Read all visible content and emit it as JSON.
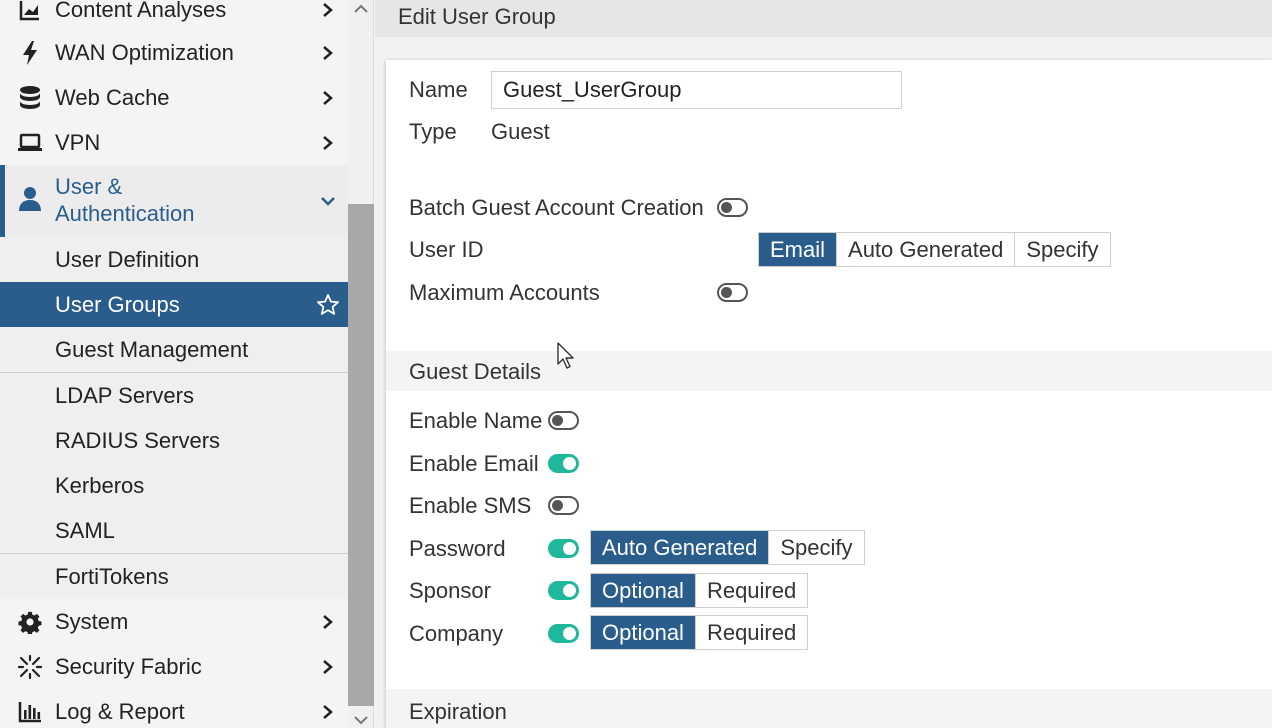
{
  "sidebar": {
    "items_top": [
      {
        "label": "Content Analyses",
        "icon": "chart-area-icon"
      },
      {
        "label": "WAN Optimization",
        "icon": "bolt-icon"
      },
      {
        "label": "Web Cache",
        "icon": "database-icon"
      },
      {
        "label": "VPN",
        "icon": "laptop-icon"
      }
    ],
    "user_auth": {
      "label_line1": "User &",
      "label_line2": "Authentication",
      "icon": "user-icon"
    },
    "sub_items": [
      {
        "label": "User Definition"
      },
      {
        "label": "User Groups"
      },
      {
        "label": "Guest Management"
      },
      {
        "label": "LDAP Servers"
      },
      {
        "label": "RADIUS Servers"
      },
      {
        "label": "Kerberos"
      },
      {
        "label": "SAML"
      },
      {
        "label": "FortiTokens"
      }
    ],
    "items_bottom": [
      {
        "label": "System",
        "icon": "gear-icon"
      },
      {
        "label": "Security Fabric",
        "icon": "security-fabric-icon"
      },
      {
        "label": "Log & Report",
        "icon": "bar-chart-icon"
      }
    ]
  },
  "page": {
    "title": "Edit User Group"
  },
  "form": {
    "name_label": "Name",
    "name_value": "Guest_UserGroup",
    "type_label": "Type",
    "type_value": "Guest",
    "batch_label": "Batch Guest Account Creation",
    "batch_enabled": false,
    "userid_label": "User ID",
    "userid_options": [
      "Email",
      "Auto Generated",
      "Specify"
    ],
    "userid_selected": "Email",
    "max_accounts_label": "Maximum Accounts",
    "max_accounts_enabled": false
  },
  "guest_details": {
    "title": "Guest Details",
    "enable_name_label": "Enable Name",
    "enable_name": false,
    "enable_email_label": "Enable Email",
    "enable_email": true,
    "enable_sms_label": "Enable SMS",
    "enable_sms": false,
    "password_label": "Password",
    "password_enabled": true,
    "password_options": [
      "Auto Generated",
      "Specify"
    ],
    "password_selected": "Auto Generated",
    "sponsor_label": "Sponsor",
    "sponsor_enabled": true,
    "sponsor_options": [
      "Optional",
      "Required"
    ],
    "sponsor_selected": "Optional",
    "company_label": "Company",
    "company_enabled": true,
    "company_options": [
      "Optional",
      "Required"
    ],
    "company_selected": "Optional"
  },
  "expiration": {
    "title": "Expiration"
  },
  "colors": {
    "accent": "#2a5d8c",
    "toggle_on": "#1fb89a"
  }
}
